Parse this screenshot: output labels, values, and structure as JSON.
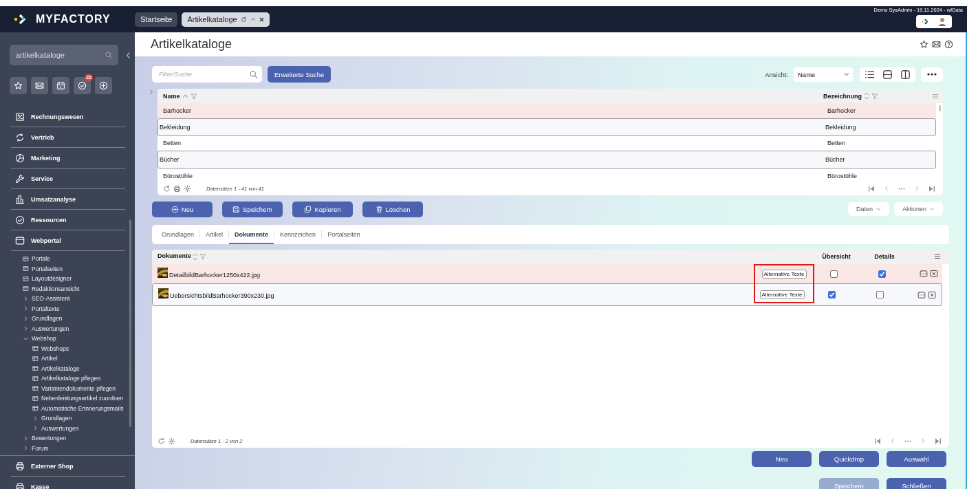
{
  "app": {
    "logo": "MYFACTORY",
    "user_info": "Demo SysAdmin - 19.11.2024 - wfData"
  },
  "tabs": [
    {
      "label": "Startseite",
      "selected": false
    },
    {
      "label": "Artikelkataloge",
      "selected": true
    }
  ],
  "sidebar": {
    "search": {
      "value": "artikelkataloge"
    },
    "quick_icons": [
      {
        "kind": "star"
      },
      {
        "kind": "mail"
      },
      {
        "kind": "calendar"
      },
      {
        "kind": "tasks",
        "badge": "22"
      },
      {
        "kind": "add"
      }
    ],
    "modules": [
      {
        "label": "Rechnungswesen",
        "kind": "calc"
      },
      {
        "label": "Vertrieb",
        "kind": "cycle"
      },
      {
        "label": "Marketing",
        "kind": "chart"
      },
      {
        "label": "Service",
        "kind": "wrench"
      },
      {
        "label": "Umsatzanalyse",
        "kind": "bars"
      },
      {
        "label": "Ressourcen",
        "kind": "check"
      },
      {
        "label": "Webportal",
        "kind": "window",
        "children": [
          {
            "label": "Portale",
            "kind": "page"
          },
          {
            "label": "Portalseiten",
            "kind": "page"
          },
          {
            "label": "Layoutdesigner",
            "kind": "page"
          },
          {
            "label": "Redaktionsansicht",
            "kind": "page"
          },
          {
            "label": "SEO-Assistent",
            "kind": "folder",
            "expanded": false
          },
          {
            "label": "Portaltexte",
            "kind": "folder",
            "expanded": false
          },
          {
            "label": "Grundlagen",
            "kind": "folder",
            "expanded": false
          },
          {
            "label": "Auswertungen",
            "kind": "folder",
            "expanded": false
          },
          {
            "label": "Webshop",
            "kind": "folder",
            "expanded": true,
            "children": [
              {
                "label": "Webshops",
                "kind": "page"
              },
              {
                "label": "Artikel",
                "kind": "page"
              },
              {
                "label": "Artikelkataloge",
                "kind": "page"
              },
              {
                "label": "Artikelkataloge pflegen",
                "kind": "page"
              },
              {
                "label": "Variantendokumente pflegen",
                "kind": "page"
              },
              {
                "label": "Nebenleistungsartikel zuordnen",
                "kind": "page"
              },
              {
                "label": "Automatische Erinnerungsmails",
                "kind": "page"
              },
              {
                "label": "Grundlagen",
                "kind": "folder",
                "expanded": false
              },
              {
                "label": "Auswertungen",
                "kind": "folder",
                "expanded": false
              }
            ]
          },
          {
            "label": "Bewertungen",
            "kind": "folder",
            "expanded": false
          },
          {
            "label": "Forum",
            "kind": "folder",
            "expanded": false
          }
        ]
      },
      {
        "label": "Externer Shop",
        "kind": "printer"
      },
      {
        "label": "Kasse",
        "kind": "printer"
      }
    ]
  },
  "page": {
    "title": "Artikelkataloge"
  },
  "filter": {
    "placeholder": "Filter/Suche"
  },
  "advanced_search_button": "Erweiterte Suche",
  "view": {
    "label": "Ansicht:",
    "value": "Name"
  },
  "catalog_table": {
    "columns": [
      {
        "label": "Name",
        "sorted": true
      },
      {
        "label": "Bezeichnung",
        "sorted": false
      }
    ],
    "rows": [
      {
        "name": "Barhocker",
        "bezeichnung": "Barhocker",
        "selected": true
      },
      {
        "name": "Bekleidung",
        "bezeichnung": "Bekleidung",
        "selected": false
      },
      {
        "name": "Betten",
        "bezeichnung": "Betten",
        "selected": false
      },
      {
        "name": "Bücher",
        "bezeichnung": "Bücher",
        "selected": false
      },
      {
        "name": "Bürostühle",
        "bezeichnung": "Bürostühle",
        "selected": false
      }
    ],
    "footer": "Datensätze 1 - 41 von 41"
  },
  "actions": [
    {
      "label": "Neu",
      "kind": "plus"
    },
    {
      "label": "Speichern",
      "kind": "save"
    },
    {
      "label": "Kopieren",
      "kind": "copy"
    },
    {
      "label": "Löschen",
      "kind": "trash"
    }
  ],
  "menus": [
    "Daten",
    "Aktionen"
  ],
  "detail_tabs": [
    {
      "label": "Grundlagen",
      "selected": false
    },
    {
      "label": "Artikel",
      "selected": false
    },
    {
      "label": "Dokumente",
      "selected": true
    },
    {
      "label": "Kennzeichen",
      "selected": false
    },
    {
      "label": "Portalseiten",
      "selected": false
    }
  ],
  "documents": {
    "columns": [
      {
        "label": "Dokumente",
        "sorted": false
      },
      {
        "label": "Übersicht"
      },
      {
        "label": "Details"
      }
    ],
    "alt_text_highlighted": true,
    "rows": [
      {
        "file": "DetailbildBarhocker1250x422.jpg",
        "alt_text_button": "Alternative Texte",
        "overview": false,
        "details": true,
        "selected": true
      },
      {
        "file": "UebersichtsbildBarhocker390x230.jpg",
        "alt_text_button": "Alternative Texte",
        "overview": true,
        "details": false,
        "selected": false
      }
    ],
    "footer": "Datensätze 1 - 2 von 2"
  },
  "bottom_buttons": [
    [
      {
        "label": "Neu",
        "disabled": false
      },
      {
        "label": "Quickdrop",
        "disabled": false
      },
      {
        "label": "Auswahl",
        "disabled": false
      }
    ],
    [
      {
        "label": "Speichern",
        "disabled": true
      },
      {
        "label": "Schließen",
        "disabled": false
      }
    ]
  ]
}
